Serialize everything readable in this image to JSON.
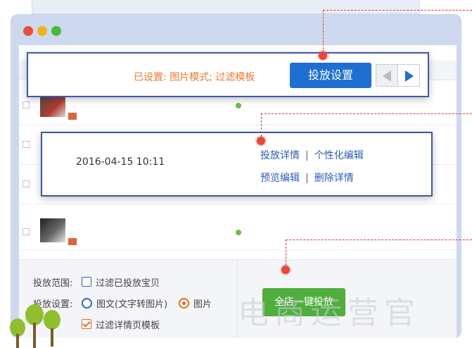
{
  "background_colors": {
    "window": "#ccd9ee",
    "accent_blue": "#1d6fd1",
    "orange": "#f07a2c",
    "green": "#4fae3c",
    "marker_red": "#e8463a"
  },
  "window": {
    "controls": [
      "close",
      "minimize",
      "maximize"
    ]
  },
  "toolbar_callout": {
    "status_text": "已设置: 图片模式; 过滤模板",
    "deploy_settings_button": "投放设置",
    "prev_icon": "arrow-left-icon",
    "next_icon": "arrow-right-icon"
  },
  "row_callout": {
    "datetime": "2016-04-15 10:11",
    "link_deploy_detail": "投放详情",
    "link_personal_edit": "个性化编辑",
    "link_preview_edit": "预览编辑",
    "link_delete_detail": "删除详情",
    "separator": "|"
  },
  "bottom_panel": {
    "scope_label": "投放范围:",
    "scope_option": "过滤已投放宝贝",
    "settings_label": "投放设置:",
    "option_text_mode": "图文(文字转图片)",
    "option_image_mode": "图片",
    "option_filter_template": "过滤详情页模板",
    "oneclick_button": "全店一键投放"
  },
  "watermark": "电商运营官"
}
